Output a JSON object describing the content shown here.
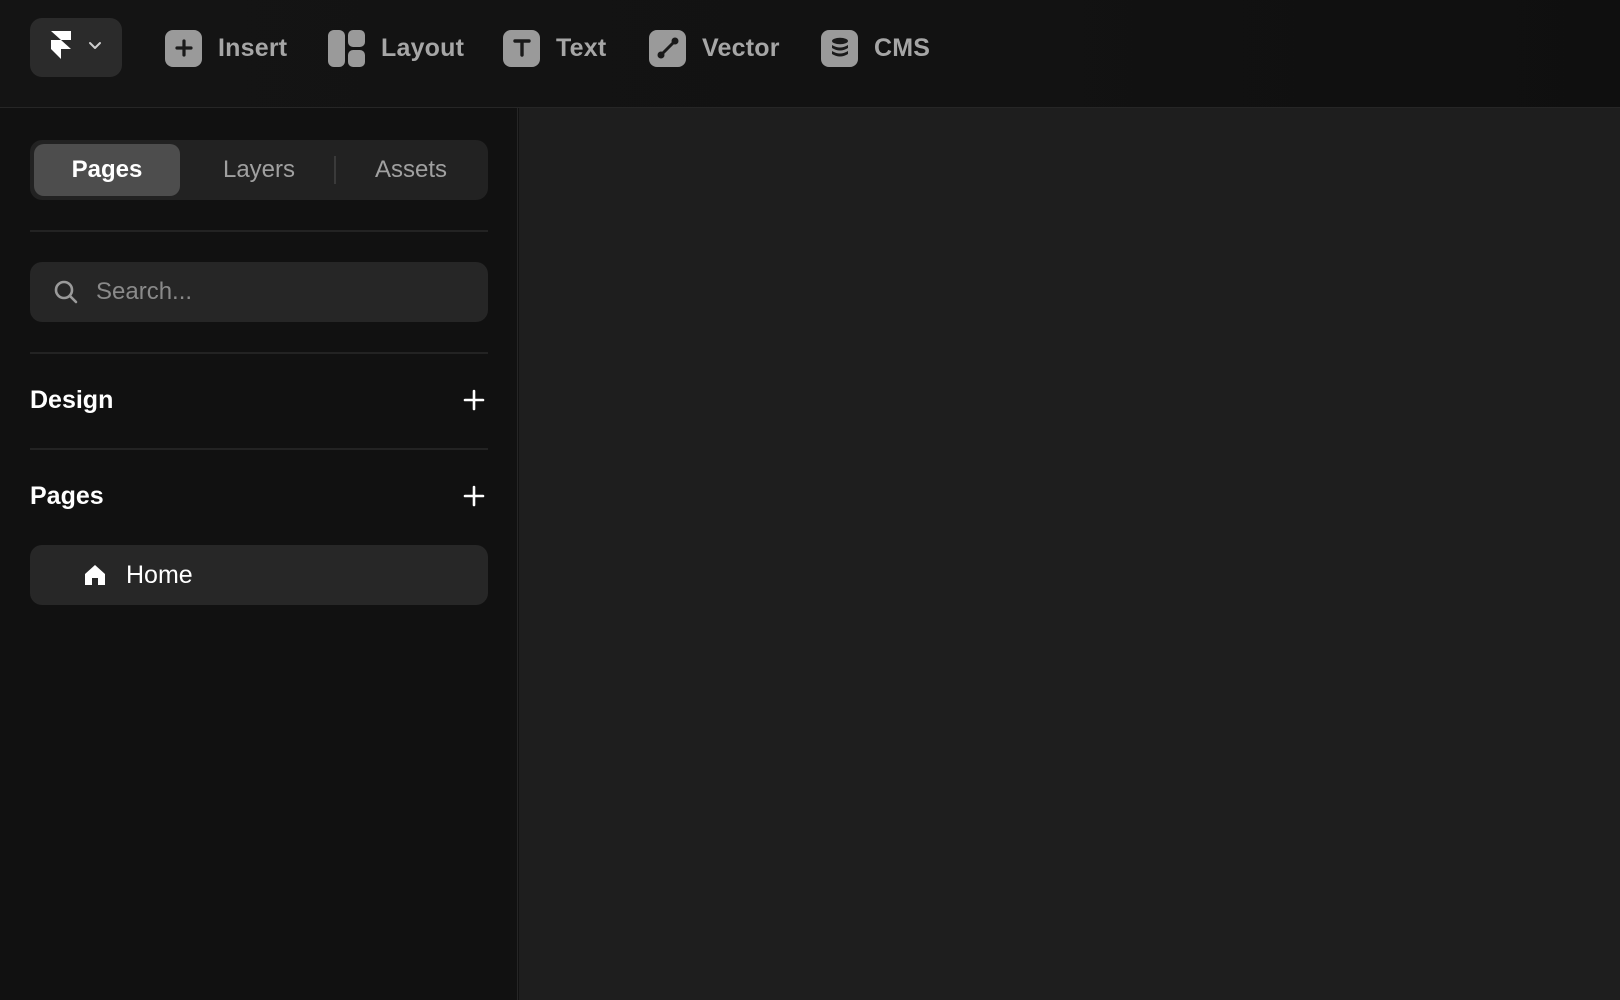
{
  "toolbar": {
    "tools": [
      {
        "label": "Insert",
        "icon": "plus-square-icon"
      },
      {
        "label": "Layout",
        "icon": "layout-grid-icon"
      },
      {
        "label": "Text",
        "icon": "text-t-icon"
      },
      {
        "label": "Vector",
        "icon": "pen-path-icon"
      },
      {
        "label": "CMS",
        "icon": "database-icon"
      }
    ]
  },
  "sidebar": {
    "tabs": [
      "Pages",
      "Layers",
      "Assets"
    ],
    "active_tab": "Pages",
    "search": {
      "placeholder": "Search..."
    },
    "sections": {
      "design": {
        "title": "Design"
      },
      "pages": {
        "title": "Pages"
      }
    },
    "page_items": [
      {
        "label": "Home",
        "icon": "home-icon"
      }
    ]
  },
  "colors": {
    "background": "#111111",
    "canvas": "#1e1e1e",
    "accent_tab": "#4d4d4d",
    "icon_gray": "#9a9a9a"
  }
}
